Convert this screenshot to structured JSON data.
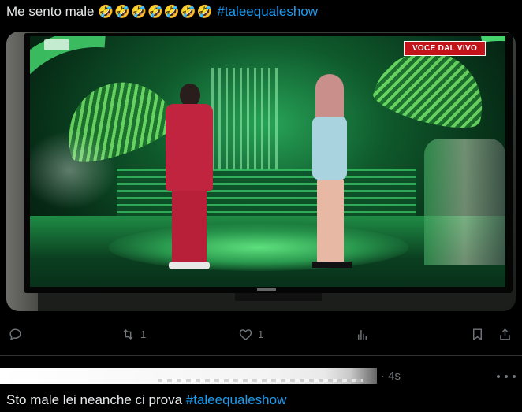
{
  "tweet1": {
    "text": "Me sento male",
    "emoji": [
      "🤣",
      "🤣",
      "🤣",
      "🤣",
      "🤣",
      "🤣",
      "🤣"
    ],
    "hashtag": "#taleequaleshow"
  },
  "media": {
    "live_badge": "VOCE DAL VIVO"
  },
  "actions": {
    "reply_count": "",
    "retweet_count": "1",
    "like_count": "1",
    "views_count": ""
  },
  "tweet2": {
    "timestamp": "· 4s",
    "text": "Sto male lei neanche ci prova",
    "hashtag": "#taleequaleshow"
  },
  "colors": {
    "accent": "#1d9bf0",
    "muted": "#71767b",
    "background": "#000000",
    "live_badge": "#c4121a"
  },
  "icons": [
    "reply-icon",
    "retweet-icon",
    "like-icon",
    "views-icon",
    "bookmark-icon",
    "share-icon",
    "more-icon"
  ]
}
